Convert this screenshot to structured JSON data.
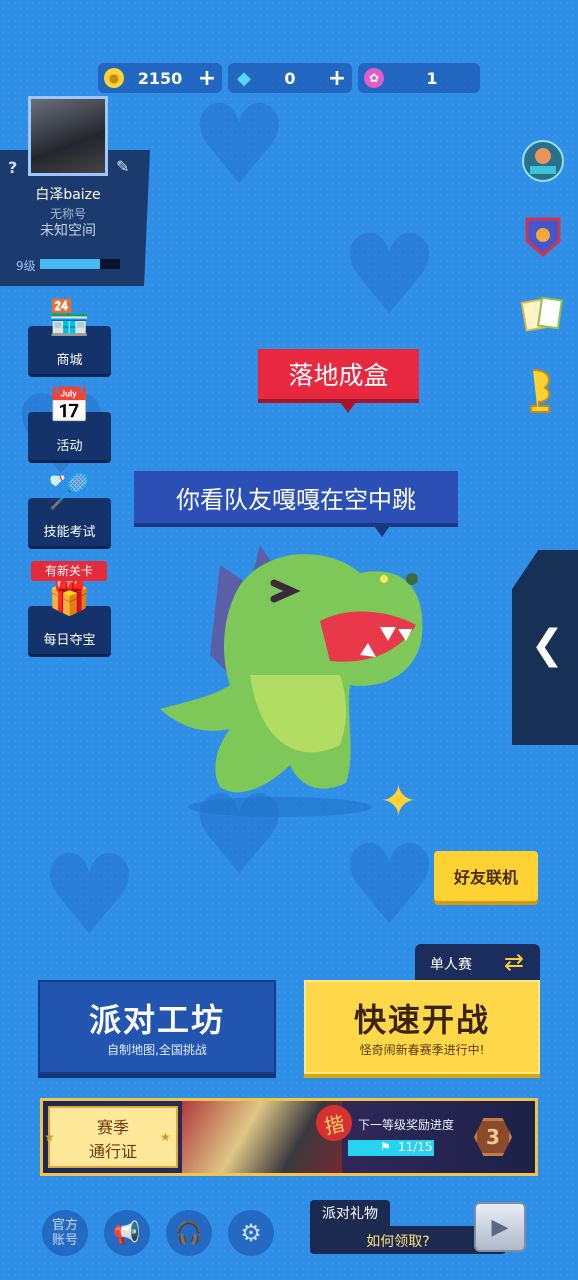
{
  "currency": {
    "coins": "2150",
    "gems": "0",
    "tokens": "1",
    "plus": "+"
  },
  "profile": {
    "name": "白泽baize",
    "title": "无称号",
    "space": "未知空间",
    "level": "9级",
    "xp_fraction": 0.75,
    "help": "?"
  },
  "left_menu": [
    {
      "label": "商城",
      "icon": "shop-icon"
    },
    {
      "label": "活动",
      "icon": "calendar-icon"
    },
    {
      "label": "技能考试",
      "icon": "skill-icon"
    },
    {
      "label": "每日夺宝",
      "icon": "treasure-chest-icon"
    }
  ],
  "new_level_tag": "有新关卡",
  "right_icons": [
    "party-card-icon",
    "shield-badge-icon",
    "cards-icon",
    "trophy-icon"
  ],
  "bubbles": {
    "red": "落地成盒",
    "blue": "你看队友嘎嘎在空中跳"
  },
  "buttons": {
    "friend": "好友联机",
    "solo": "单人赛",
    "workshop_title": "派对工坊",
    "workshop_sub": "自制地图,全国挑战",
    "quick_title": "快速开战",
    "quick_sub": "怪奇闹新春赛季进行中!"
  },
  "season_pass": {
    "line1": "赛季",
    "line2": "通行证",
    "next_reward": "下一等级奖励进度",
    "progress": "11/15",
    "progress_fraction": 0.733,
    "level": "3",
    "tag": "揩"
  },
  "bottom": {
    "official": "官方\n账号",
    "official_1": "官方",
    "official_2": "账号",
    "gift_label": "派对礼物",
    "gift_how": "如何领取?"
  },
  "colors": {
    "background": "#2f8fe6",
    "accent_yellow": "#ffd84a",
    "accent_red": "#e8283e",
    "panel_dark": "#1b3a6e"
  }
}
